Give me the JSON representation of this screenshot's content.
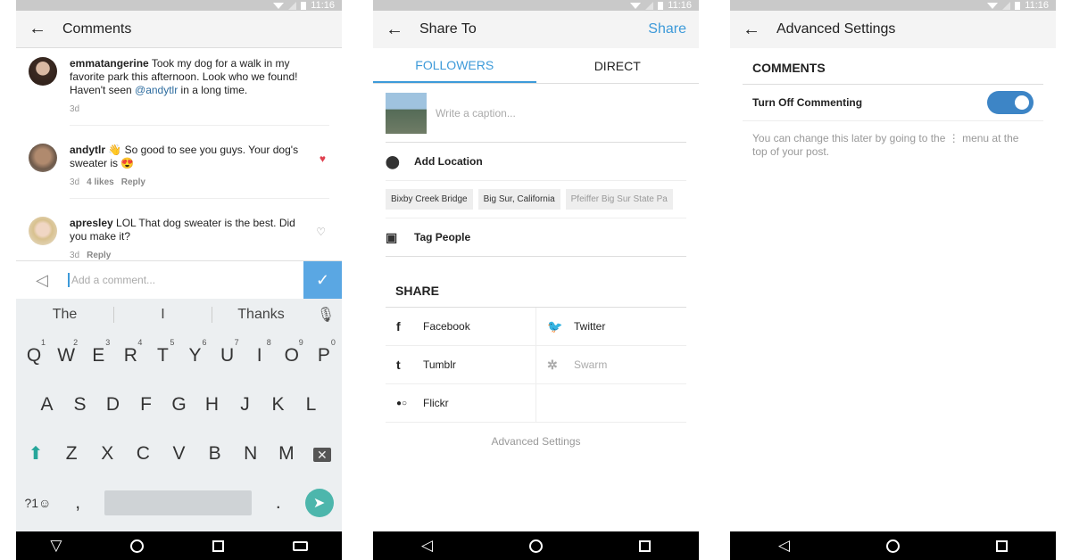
{
  "status_time": "11:16",
  "comments_screen": {
    "title": "Comments",
    "comments": [
      {
        "user": "emmatangerine",
        "text": "Took my dog for a walk in my favorite park this afternoon. Look who we found! Haven't seen ",
        "mention": "@andytlr",
        "text_after": " in a long time.",
        "time": "3d",
        "likes": "",
        "reply": "",
        "liked": false,
        "heart": ""
      },
      {
        "user": "andytlr",
        "text": "👋 So good to see you guys. Your dog's sweater is 😍",
        "mention": "",
        "text_after": "",
        "time": "3d",
        "likes": "4 likes",
        "reply": "Reply",
        "liked": true,
        "heart": "♥"
      },
      {
        "user": "apresley",
        "text": "LOL That dog sweater is the best. Did you make it?",
        "mention": "",
        "text_after": "",
        "time": "3d",
        "likes": "",
        "reply": "Reply",
        "liked": false,
        "heart": "♡"
      }
    ],
    "input_placeholder": "Add a comment...",
    "keyboard": {
      "suggestions": [
        "The",
        "I",
        "Thanks"
      ],
      "row1": [
        "Q",
        "W",
        "E",
        "R",
        "T",
        "Y",
        "U",
        "I",
        "O",
        "P"
      ],
      "row1_nums": [
        "1",
        "2",
        "3",
        "4",
        "5",
        "6",
        "7",
        "8",
        "9",
        "0"
      ],
      "row2": [
        "A",
        "S",
        "D",
        "F",
        "G",
        "H",
        "J",
        "K",
        "L"
      ],
      "row3": [
        "Z",
        "X",
        "C",
        "V",
        "B",
        "N",
        "M"
      ],
      "symbols_key": "?1☺",
      "comma": ",",
      "period": "."
    }
  },
  "share_screen": {
    "title": "Share To",
    "action": "Share",
    "tabs": [
      "FOLLOWERS",
      "DIRECT"
    ],
    "caption_placeholder": "Write a caption...",
    "add_location": "Add Location",
    "location_chips": [
      "Bixby Creek Bridge",
      "Big Sur, California",
      "Pfeiffer Big Sur State Pa"
    ],
    "tag_people": "Tag People",
    "share_heading": "SHARE",
    "networks": [
      {
        "name": "Facebook",
        "icon": "f",
        "enabled": true
      },
      {
        "name": "Twitter",
        "icon": "🐦",
        "enabled": true
      },
      {
        "name": "Tumblr",
        "icon": "t",
        "enabled": true
      },
      {
        "name": "Swarm",
        "icon": "✲",
        "enabled": false
      },
      {
        "name": "Flickr",
        "icon": "●○",
        "enabled": true
      }
    ],
    "advanced_link": "Advanced Settings"
  },
  "advanced_screen": {
    "title": "Advanced Settings",
    "section": "COMMENTS",
    "toggle_label": "Turn Off Commenting",
    "toggle_on": true,
    "help_text_before": "You can change this later by going to the",
    "help_text_icon": "⋮",
    "help_text_after": "menu at the top of your post."
  }
}
